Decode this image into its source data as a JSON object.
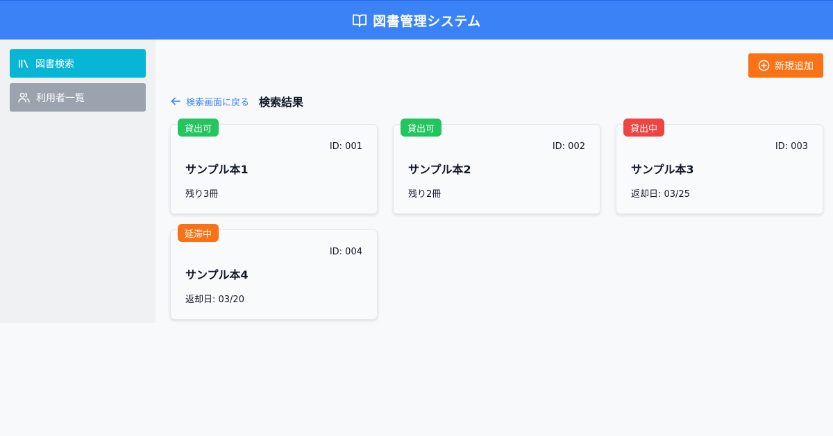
{
  "header": {
    "title": "図書管理システム",
    "icon": "book-open-icon"
  },
  "sidebar": {
    "items": [
      {
        "label": "図書検索",
        "icon": "library-icon",
        "active": true
      },
      {
        "label": "利用者一覧",
        "icon": "users-icon",
        "active": false
      }
    ]
  },
  "toolbar": {
    "add_label": "新規追加",
    "add_icon": "plus-circle-icon"
  },
  "breadcrumb": {
    "back_label": "検索画面に戻る",
    "title": "検索結果"
  },
  "colors": {
    "header": "#3b82f6",
    "nav_active": "#06b6d4",
    "nav_inactive": "#9ca3af",
    "add_button": "#f97316",
    "status_available": "#22c55e",
    "status_lent": "#ef4444",
    "status_overdue": "#f97316"
  },
  "books": [
    {
      "status": "貸出可",
      "status_color": "#22c55e",
      "id": "ID: 001",
      "title": "サンプル本1",
      "info": "残り3冊"
    },
    {
      "status": "貸出可",
      "status_color": "#22c55e",
      "id": "ID: 002",
      "title": "サンプル本2",
      "info": "残り2冊"
    },
    {
      "status": "貸出中",
      "status_color": "#ef4444",
      "id": "ID: 003",
      "title": "サンプル本3",
      "info": "返却日: 03/25"
    },
    {
      "status": "延滞中",
      "status_color": "#f97316",
      "id": "ID: 004",
      "title": "サンプル本4",
      "info": "返却日: 03/20"
    }
  ]
}
